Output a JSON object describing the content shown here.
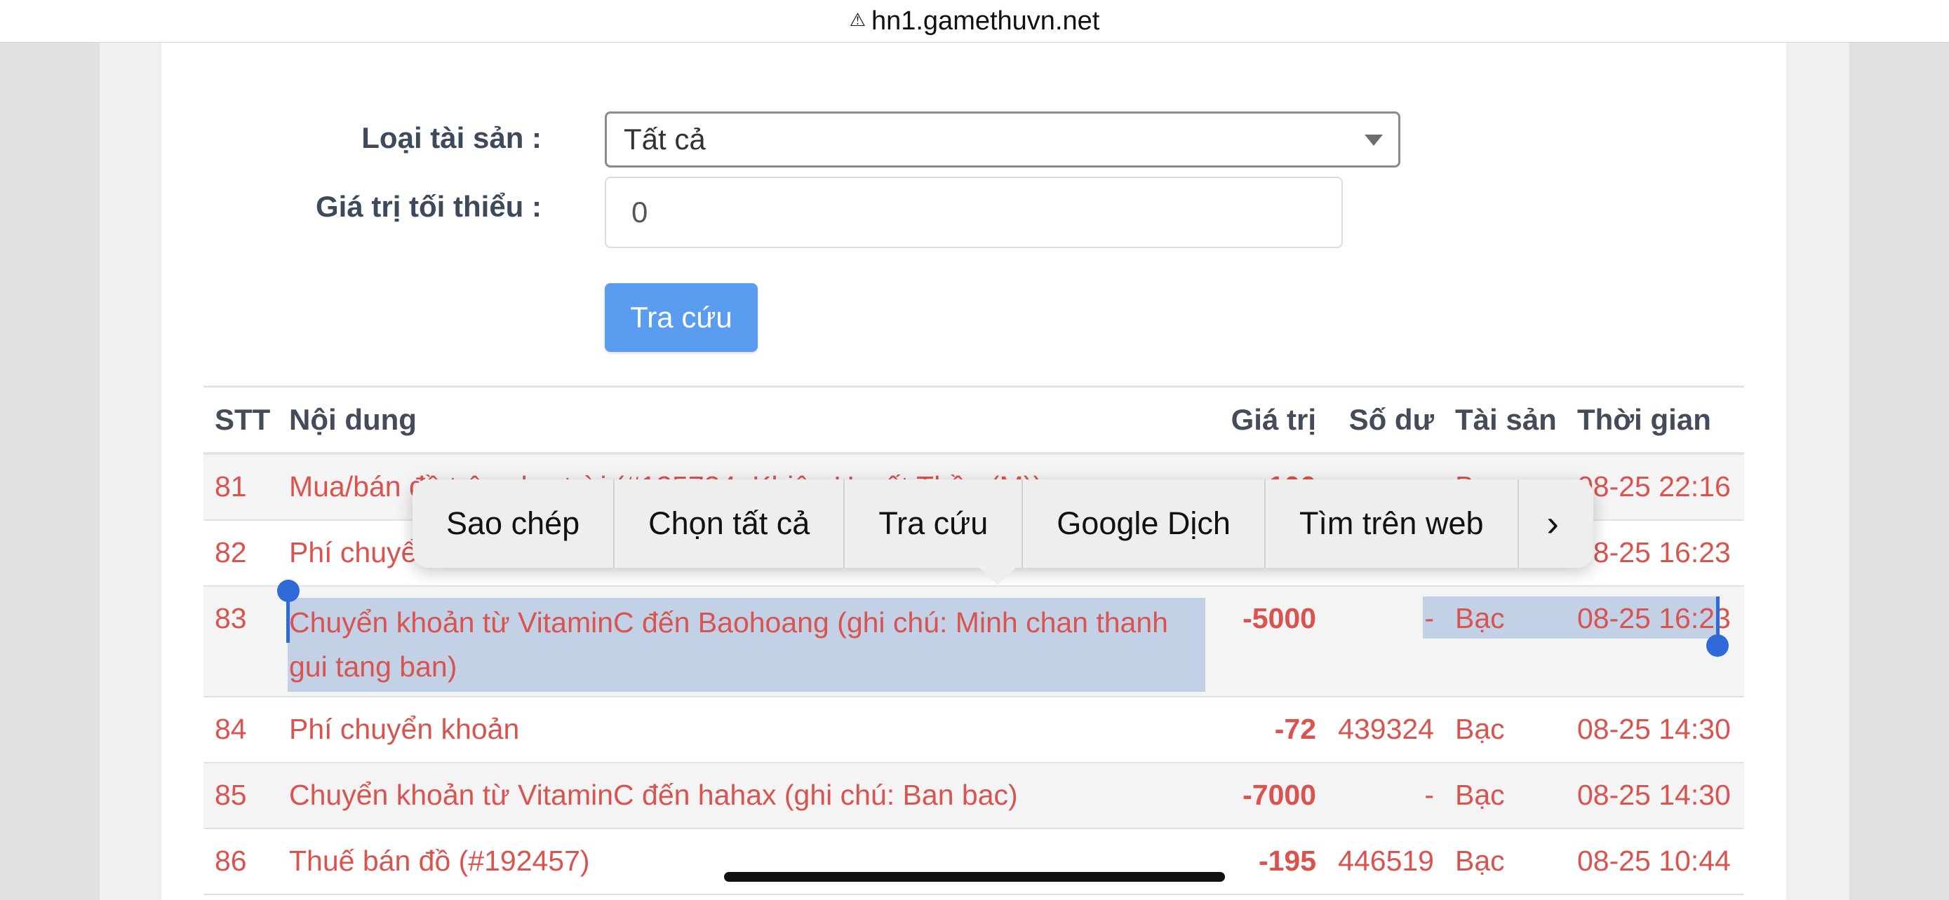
{
  "browser": {
    "url": "hn1.gamethuvn.net"
  },
  "form": {
    "asset_type_label": "Loại tài sản :",
    "asset_type_value": "Tất cả",
    "min_value_label": "Giá trị tối thiểu :",
    "min_value_value": "0",
    "search_button": "Tra cứu"
  },
  "table": {
    "headers": {
      "stt": "STT",
      "content": "Nội dung",
      "value": "Giá trị",
      "balance": "Số dư",
      "asset": "Tài sản",
      "time": "Thời gian"
    },
    "rows": [
      {
        "stt": "81",
        "content": "Mua/bán đồ trên chợ trời (#135734: Khiên Huyết Thần (M))",
        "value": "-100",
        "balance": "",
        "asset": "Bạc",
        "time": "08-25 22:16"
      },
      {
        "stt": "82",
        "content": "Phí chuyển khoản",
        "value": "",
        "balance": "",
        "asset": "",
        "time": "08-25 16:23"
      },
      {
        "stt": "83",
        "content": "Chuyển khoản từ VitaminC đến Baohoang (ghi chú: Minh chan thanh gui tang ban)",
        "value": "-5000",
        "balance": "-",
        "asset": "Bạc",
        "time": "08-25 16:23"
      },
      {
        "stt": "84",
        "content": "Phí chuyển khoản",
        "value": "-72",
        "balance": "439324",
        "asset": "Bạc",
        "time": "08-25 14:30"
      },
      {
        "stt": "85",
        "content": "Chuyển khoản từ VitaminC đến hahax (ghi chú: Ban bac)",
        "value": "-7000",
        "balance": "-",
        "asset": "Bạc",
        "time": "08-25 14:30"
      },
      {
        "stt": "86",
        "content": "Thuế bán đồ (#192457)",
        "value": "-195",
        "balance": "446519",
        "asset": "Bạc",
        "time": "08-25 10:44"
      }
    ]
  },
  "context_menu": {
    "items": [
      "Sao chép",
      "Chọn tất cả",
      "Tra cứu",
      "Google Dịch",
      "Tìm trên web"
    ],
    "more_icon": "chevron-right-icon"
  },
  "colors": {
    "accent_button": "#5a9cf0",
    "row_text": "#d9534f",
    "selection": "#c3d1e6",
    "handle": "#2f6bd8"
  }
}
